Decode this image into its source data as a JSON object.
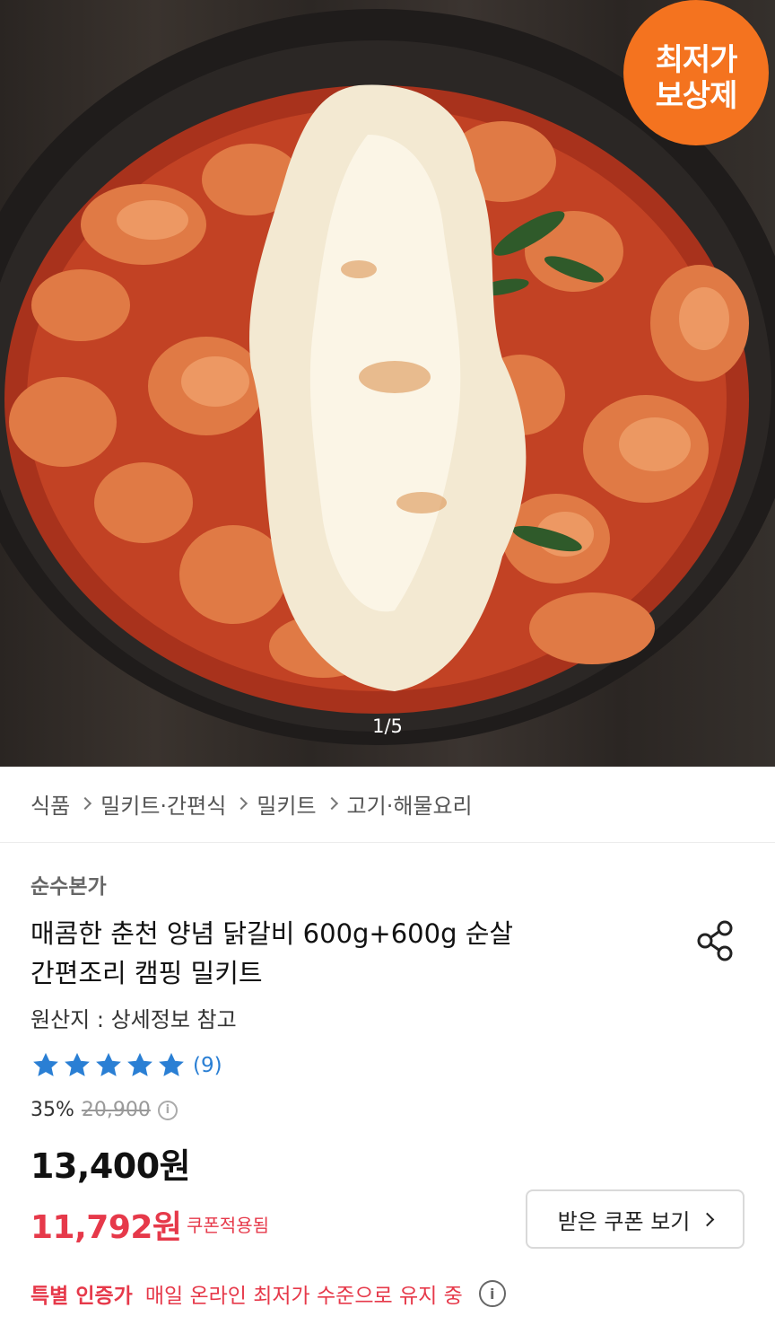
{
  "hero": {
    "badge_line1": "최저가",
    "badge_line2": "보상제",
    "counter": "1/5"
  },
  "breadcrumb": [
    "식품",
    "밀키트·간편식",
    "밀키트",
    "고기·해물요리"
  ],
  "product": {
    "brand": "순수본가",
    "title_line1": "매콤한 춘천 양념 닭갈비 600g+600g 순살",
    "title_line2": "간편조리 캠핑 밀키트",
    "origin": "원산지 : 상세정보 참고",
    "rating_stars": 5,
    "rating_count": "(9)",
    "discount_pct": "35%",
    "original_price": "20,900",
    "price": "13,400원",
    "coupon_price": "11,792원",
    "coupon_applied_label": "쿠폰적용됨",
    "coupon_button_label": "받은 쿠폰 보기",
    "special_label": "특별 인증가",
    "special_text": "매일 온라인 최저가 수준으로 유지 중"
  },
  "colors": {
    "accent_red": "#e6394a",
    "badge_orange": "#f4731f",
    "star_blue": "#2a7fd4"
  },
  "icons": [
    "share-icon",
    "star-icon",
    "info-icon",
    "chevron-right-icon"
  ]
}
